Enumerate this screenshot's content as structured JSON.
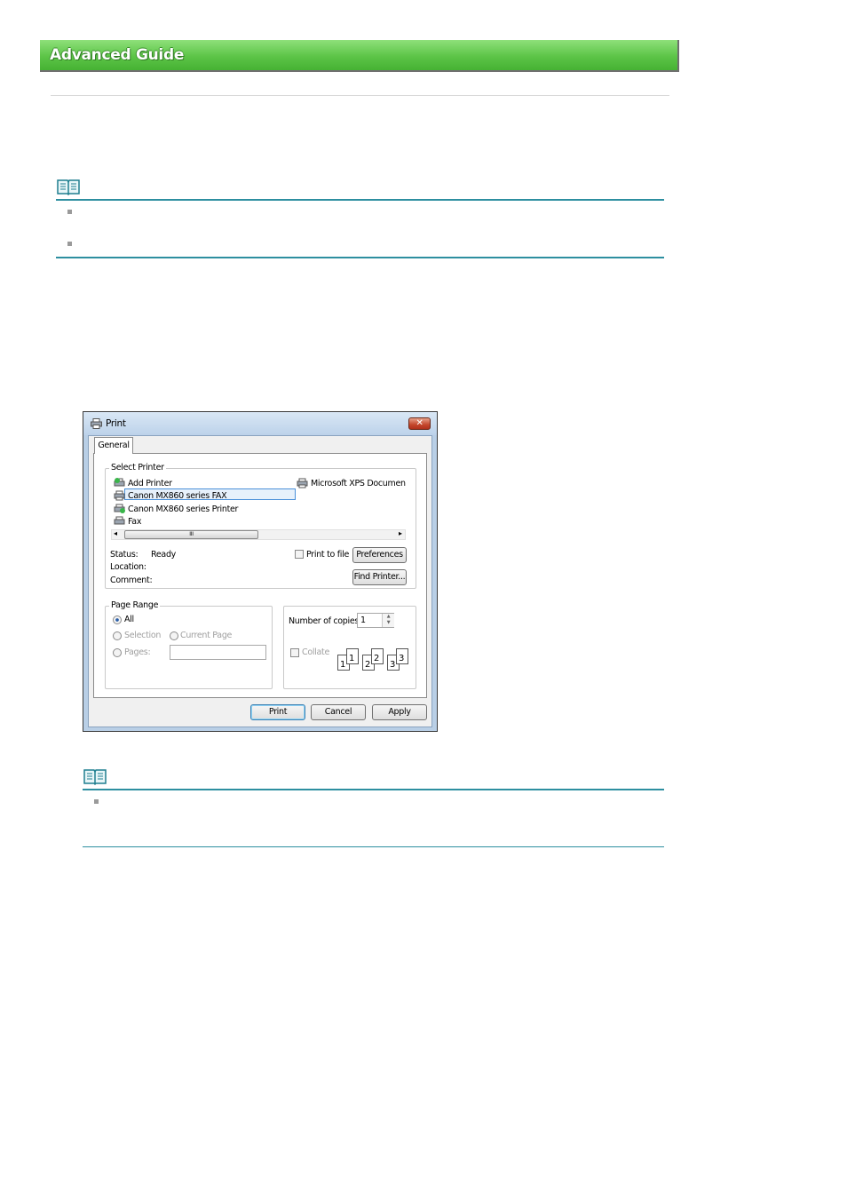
{
  "header": {
    "title": "Advanced Guide"
  },
  "dialog": {
    "title": "Print",
    "close_label": "✕",
    "tab_general": "General",
    "select_printer": {
      "label": "Select Printer",
      "printers": [
        {
          "name": "Add Printer",
          "icon": "add-printer-icon"
        },
        {
          "name": "Canon MX860 series FAX",
          "icon": "fax-printer-icon",
          "selected": true
        },
        {
          "name": "Canon MX860 series Printer",
          "icon": "default-printer-icon"
        },
        {
          "name": "Fax",
          "icon": "fax-icon"
        },
        {
          "name": "Microsoft XPS Documen",
          "icon": "printer-icon"
        }
      ],
      "scroll_grip": "III",
      "scroll_left": "◂",
      "scroll_right": "▸"
    },
    "status_label": "Status:",
    "status_value": "Ready",
    "location_label": "Location:",
    "comment_label": "Comment:",
    "print_to_file_label": "Print to file",
    "preferences_label": "Preferences",
    "find_printer_label": "Find Printer...",
    "page_range": {
      "label": "Page Range",
      "all_label": "All",
      "selection_label": "Selection",
      "current_page_label": "Current Page",
      "pages_label": "Pages:",
      "pages_value": ""
    },
    "copies": {
      "label": "Number of copies:",
      "value": "1",
      "collate_label": "Collate",
      "page_numbers": [
        "1",
        "1",
        "2",
        "2",
        "3",
        "3"
      ]
    },
    "buttons": {
      "print": "Print",
      "cancel": "Cancel",
      "apply": "Apply"
    }
  },
  "colors": {
    "banner_green": "#5cc447",
    "note_rule": "#2d8fa0"
  }
}
